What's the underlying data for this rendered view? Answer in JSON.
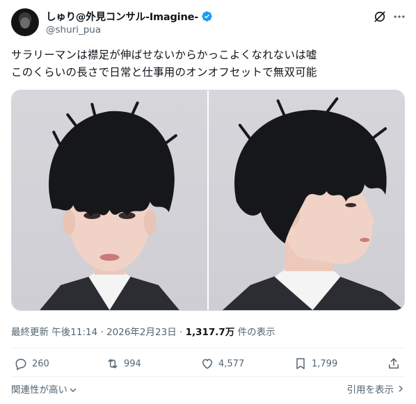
{
  "author": {
    "display_name": "しゅり@外見コンサル-Imagine-",
    "handle": "@shuri_pua",
    "verified_icon": "verified-badge-icon",
    "avatar_icon": "avatar"
  },
  "header_icons": {
    "grok": "grok-icon",
    "more": "more-icon"
  },
  "tweet": {
    "lines": [
      "サラリーマンは襟足が伸ばせないからかっこよくなれないは嘘",
      "このくらいの長さで日常と仕事用のオンオフセットで無双可能"
    ]
  },
  "media": {
    "photo_count": 2,
    "photos": [
      "front-portrait",
      "side-profile-portrait"
    ]
  },
  "meta": {
    "prefix": "最終更新 午後11:14 · 2026年2月23日 · ",
    "views": "1,317.7万",
    "views_suffix": " 件の表示"
  },
  "actions": {
    "replies": "260",
    "reposts": "994",
    "likes": "4,577",
    "bookmarks": "1,799"
  },
  "footer": {
    "relevance": "関連性が高い",
    "quotes": "引用を表示"
  },
  "colors": {
    "accent": "#1d9bf0",
    "muted": "#536471",
    "text": "#0f1419"
  }
}
